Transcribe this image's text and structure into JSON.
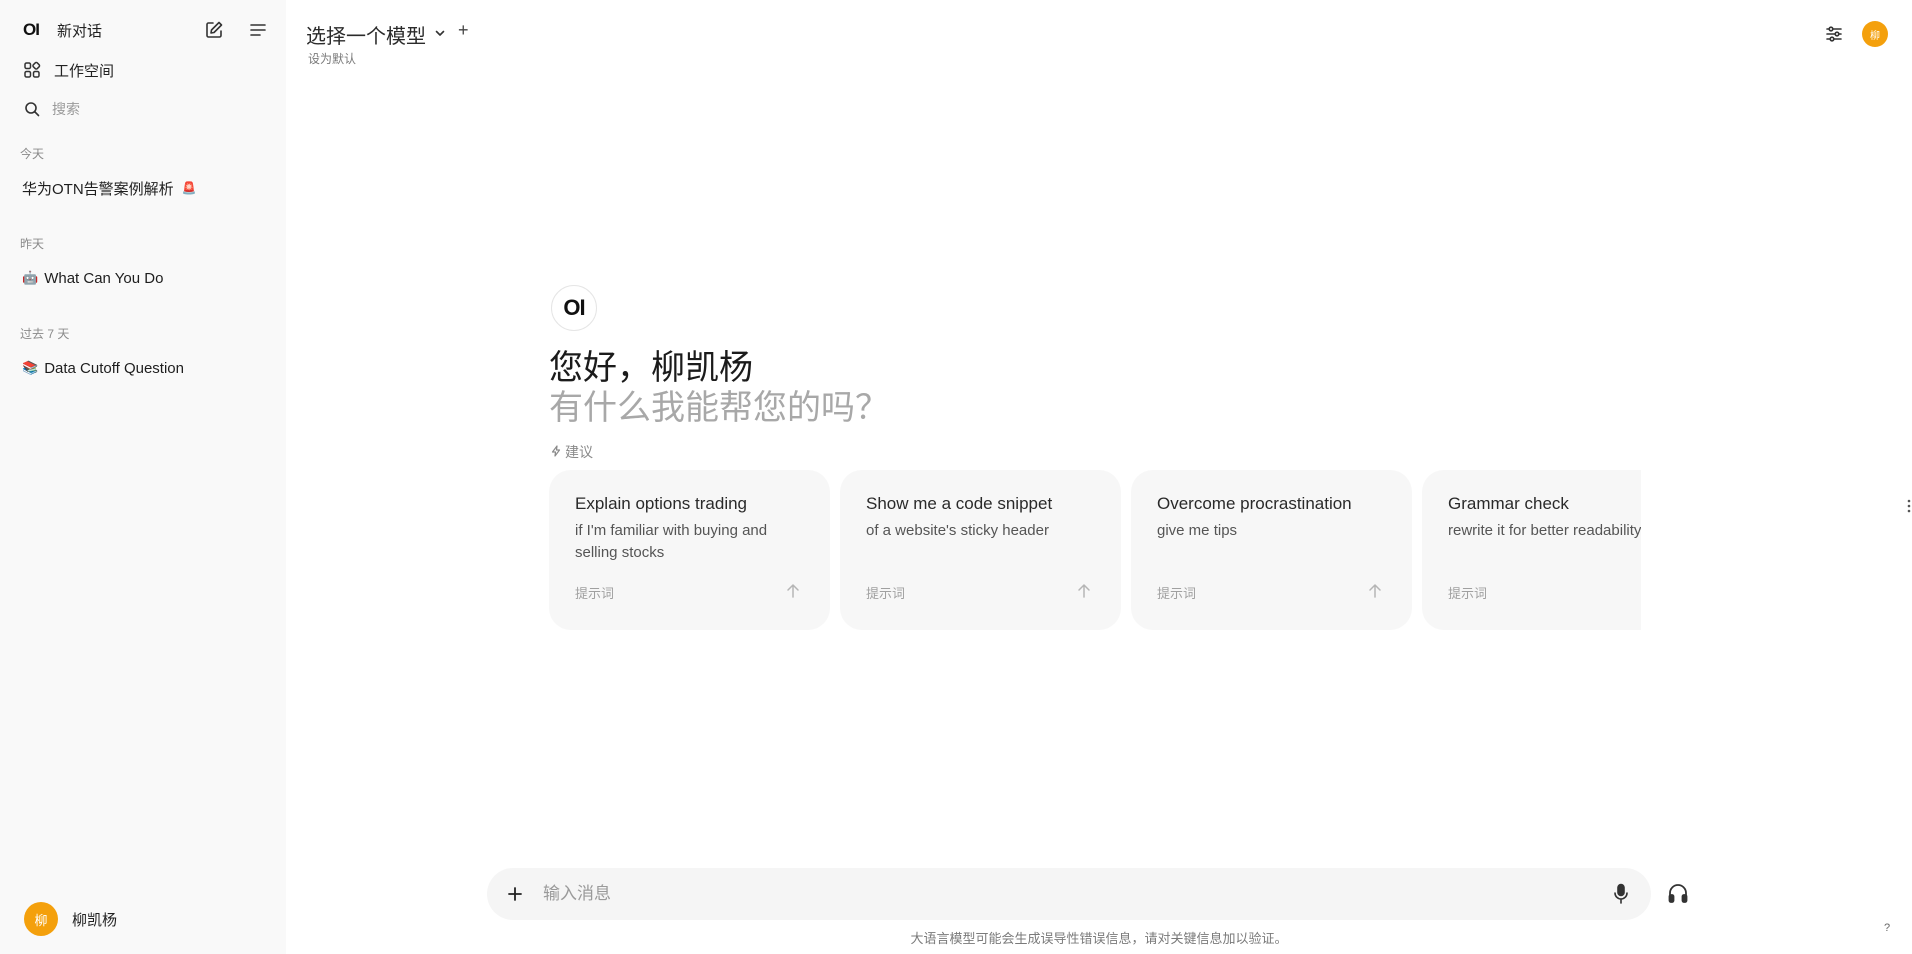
{
  "sidebar": {
    "logo": "OI",
    "new_chat": "新对话",
    "workspace": "工作空间",
    "search_placeholder": "搜索",
    "groups": [
      {
        "label": "今天",
        "items": [
          {
            "title": "华为OTN告警案例解析",
            "emoji_after": "🚨"
          }
        ]
      },
      {
        "label": "昨天",
        "items": [
          {
            "title": "What Can You Do",
            "emoji": "🤖"
          }
        ]
      },
      {
        "label": "过去 7 天",
        "items": [
          {
            "title": "Data Cutoff Question",
            "emoji": "📚"
          }
        ]
      }
    ],
    "user": {
      "avatar_char": "柳",
      "name": "柳凯杨"
    }
  },
  "header": {
    "model_select": "选择一个模型",
    "set_default": "设为默认",
    "plus": "+",
    "avatar_char": "柳"
  },
  "main": {
    "logo": "OI",
    "greeting": "您好，柳凯杨",
    "greeting_sub": "有什么我能帮您的吗？",
    "suggestions_label": "建议",
    "cards": [
      {
        "title": "Explain options trading",
        "subtitle": "if I'm familiar with buying and selling stocks",
        "kw": "提示词"
      },
      {
        "title": "Show me a code snippet",
        "subtitle": "of a website's sticky header",
        "kw": "提示词"
      },
      {
        "title": "Overcome procrastination",
        "subtitle": "give me tips",
        "kw": "提示词"
      },
      {
        "title": "Grammar check",
        "subtitle": "rewrite it for better readability",
        "kw": "提示词"
      }
    ]
  },
  "composer": {
    "placeholder": "输入消息",
    "disclaimer": "大语言模型可能会生成误导性错误信息，请对关键信息加以验证。",
    "help": "?"
  },
  "colors": {
    "accent_avatar": "#f4a00c",
    "sidebar_bg": "#f9f9f9",
    "card_bg": "#f7f7f7"
  }
}
